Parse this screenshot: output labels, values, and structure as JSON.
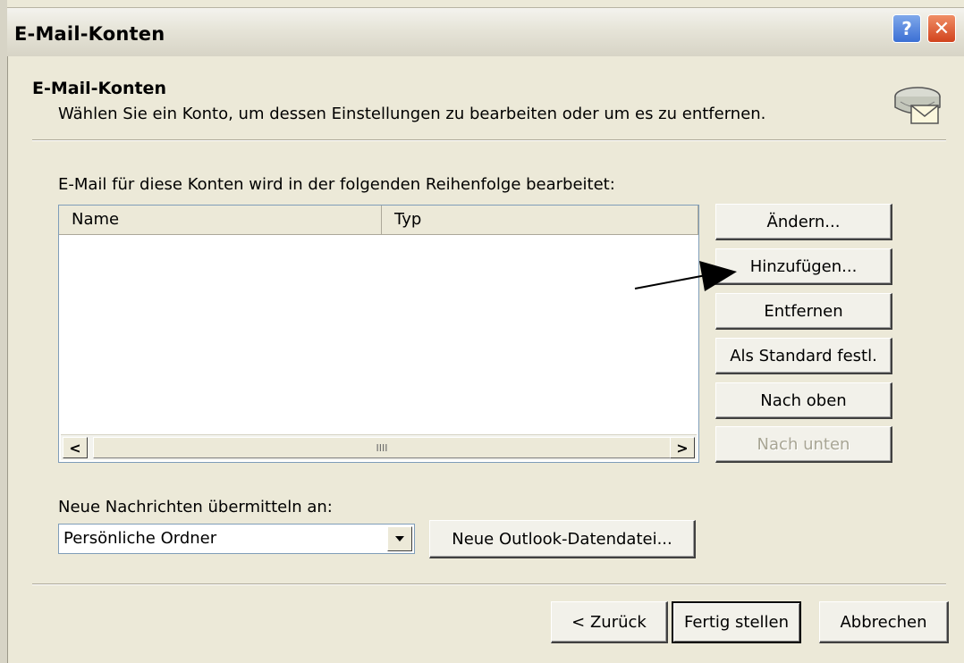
{
  "window": {
    "title": "E-Mail-Konten",
    "help_symbol": "?",
    "close_symbol": "✕"
  },
  "header": {
    "title": "E-Mail-Konten",
    "subtitle": "Wählen Sie ein Konto, um dessen Einstellungen zu bearbeiten oder um es zu entfernen.",
    "icon": "mail-accounts-icon"
  },
  "accounts": {
    "label": "E-Mail für diese Konten wird in der folgenden Reihenfolge bearbeitet:",
    "columns": [
      "Name",
      "Typ"
    ],
    "rows": [],
    "scroll_left": "<",
    "scroll_right": ">",
    "thumb_grip": "IIII"
  },
  "side_buttons": {
    "change": "Ändern...",
    "add": "Hinzufügen...",
    "remove": "Entfernen",
    "set_default": "Als Standard festl.",
    "move_up": "Nach oben",
    "move_down": "Nach unten"
  },
  "delivery": {
    "label": "Neue Nachrichten übermitteln an:",
    "selected": "Persönliche Ordner",
    "new_data_file": "Neue Outlook-Datendatei..."
  },
  "footer": {
    "back": "< Zurück",
    "finish": "Fertig stellen",
    "cancel": "Abbrechen"
  },
  "colors": {
    "dialog_background": "#ece9d8",
    "field_border": "#7f9db9",
    "close_button": "#d2431d",
    "help_button": "#3b6fd4",
    "disabled_text": "#a8a594"
  }
}
